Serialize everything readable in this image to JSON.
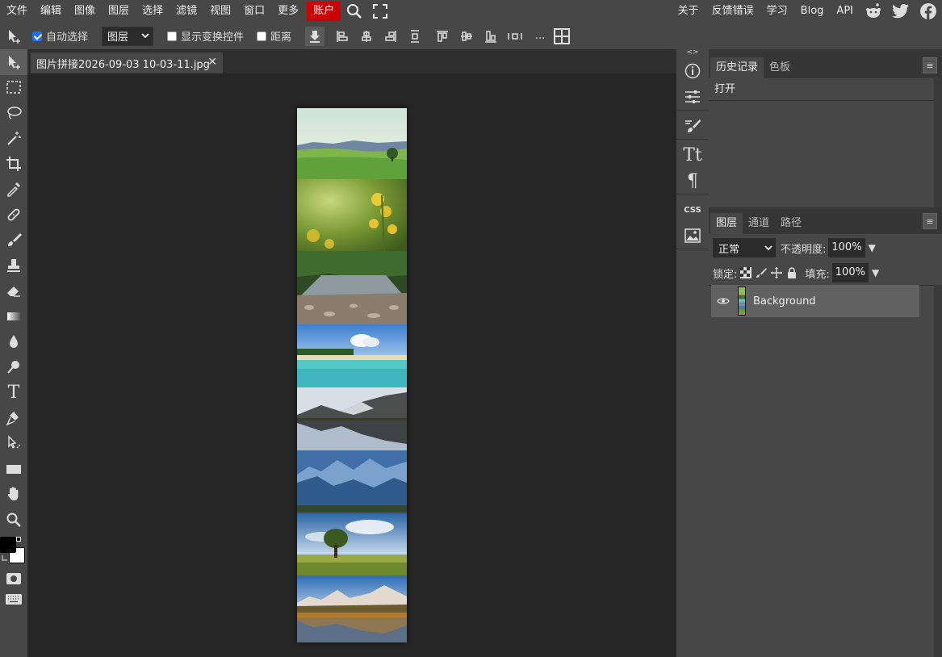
{
  "menu": {
    "left": [
      "文件",
      "编辑",
      "图像",
      "图层",
      "选择",
      "滤镜",
      "视图",
      "窗口",
      "更多"
    ],
    "account": "账户",
    "right": [
      "关于",
      "反馈错误",
      "学习",
      "Blog",
      "API"
    ]
  },
  "options": {
    "auto_select_label": "自动选择",
    "auto_select_checked": true,
    "target_select": "图层",
    "show_transform_label": "显示变换控件",
    "distance_label": "距离",
    "more_label": "..."
  },
  "document": {
    "tab_title": "图片拼接2026-09-03 10-03-11.jpg",
    "close_symbol": "✕",
    "images": [
      "meadow-landscape",
      "yellow-flowers",
      "forest-river",
      "tropical-beach",
      "mountain-lake-reflection",
      "blue-mountain-range",
      "tree-on-field",
      "autumn-mountain-lake"
    ]
  },
  "side_panel": {
    "collapse_left": "<>",
    "collapse_right": "><",
    "css_label": "CSS"
  },
  "history_panel": {
    "tabs": [
      "历史记录",
      "色板"
    ],
    "items": [
      "打开"
    ]
  },
  "layers_panel": {
    "tabs": [
      "图层",
      "通道",
      "路径"
    ],
    "blend_mode": "正常",
    "opacity_label": "不透明度:",
    "opacity_value": "100%",
    "lock_label": "锁定:",
    "fill_label": "填充:",
    "fill_value": "100%",
    "layers": [
      {
        "name": "Background",
        "visible": true
      }
    ]
  },
  "colors": {
    "accent": "#cc0000",
    "foreground": "#000000",
    "background": "#ffffff"
  }
}
